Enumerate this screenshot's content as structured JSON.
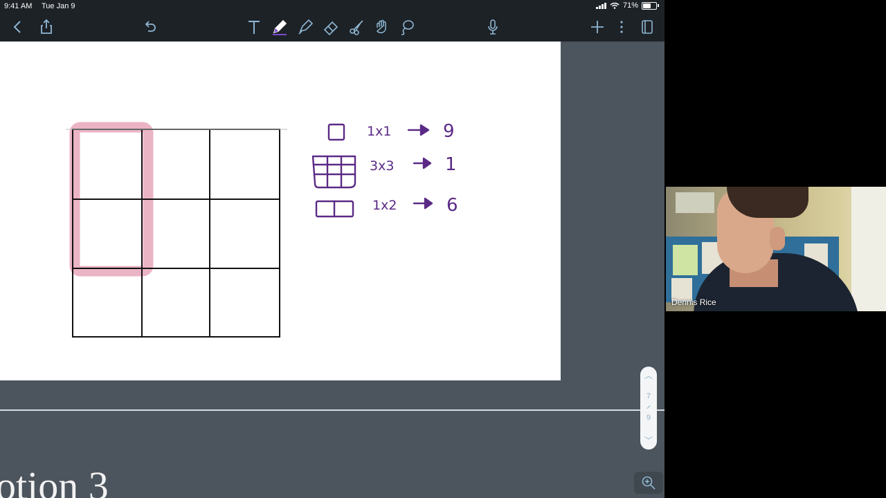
{
  "status_bar": {
    "time": "9:41 AM",
    "date": "Tue Jan 9",
    "battery_text": "71%",
    "battery_level": 0.71
  },
  "toolbar": {
    "icons": [
      "back-icon",
      "share-icon",
      "undo-icon",
      "text-tool-icon",
      "pen-tool-icon",
      "highlighter-tool-icon",
      "eraser-tool-icon",
      "scissors-tool-icon",
      "hand-tool-icon",
      "lasso-tool-icon",
      "microphone-icon",
      "add-icon",
      "more-icon",
      "pages-icon"
    ],
    "active_tool": "pen-tool-icon",
    "active_color": "#7a4bd0",
    "icon_color": "#8fb7d3"
  },
  "notes": {
    "rows": [
      {
        "size": "1x1",
        "count": "9"
      },
      {
        "size": "3x3",
        "count": "1"
      },
      {
        "size": "1x2",
        "count": "6"
      }
    ],
    "ink_color": "#5b2a86",
    "highlight_color": "#e8a7bb"
  },
  "scroller": {
    "current_page": "7",
    "total_pages": "9"
  },
  "next_page_title": "otion 3",
  "webcam": {
    "name": "Dennis Rice"
  }
}
